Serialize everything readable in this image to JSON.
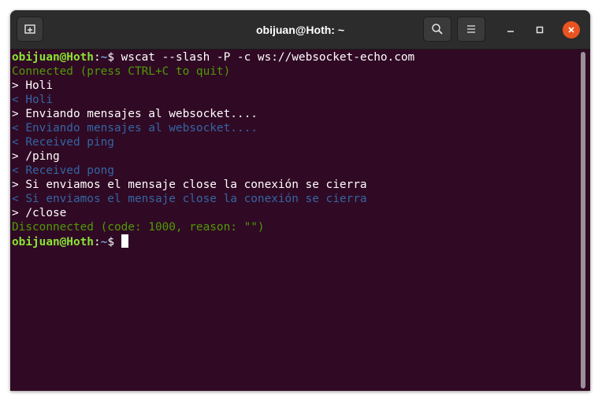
{
  "window": {
    "title": "obijuan@Hoth: ~"
  },
  "titlebar": {
    "new_tab_icon": "new-tab-icon",
    "search_icon": "search-icon",
    "menu_icon": "hamburger-menu-icon",
    "minimize_icon": "minimize-icon",
    "maximize_icon": "maximize-icon",
    "close_icon": "close-icon"
  },
  "terminal": {
    "prompt_user": "obijuan@Hoth",
    "prompt_sep": ":",
    "prompt_path": "~",
    "prompt_symbol": "$ ",
    "command": "wscat --slash -P -c ws://websocket-echo.com",
    "lines": [
      "Connected (press CTRL+C to quit)",
      "> Holi",
      "< Holi",
      "> Enviando mensajes al websocket....",
      "< Enviando mensajes al websocket....",
      "< Received ping",
      "> /ping",
      "< Received pong",
      "> Si enviamos el mensaje close la conexión se cierra",
      "< Si enviamos el mensaje close la conexión se cierra",
      "> /close",
      "Disconnected (code: 1000, reason: \"\")"
    ]
  },
  "colors": {
    "background": "#300a24",
    "titlebar": "#2c2c2c",
    "status_green": "#4e9a06",
    "received_blue": "#3465a4",
    "prompt_user_green": "#8ae234",
    "prompt_path_blue": "#729fcf",
    "close_button": "#e95420"
  }
}
